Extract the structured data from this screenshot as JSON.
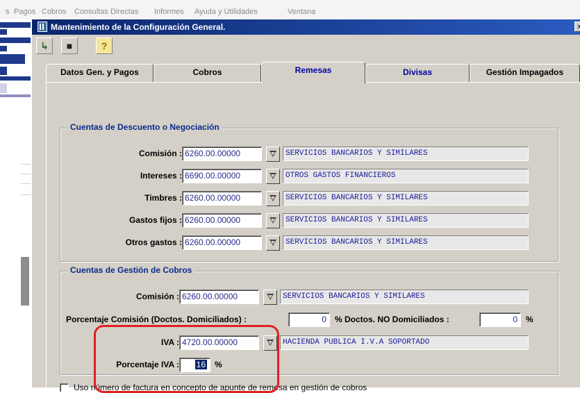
{
  "menubar": {
    "items": [
      "s",
      "Pagos",
      "Cobros",
      "Consultas Directas",
      "Informes",
      "Ayuda y Utilidades",
      "Ventana"
    ]
  },
  "window": {
    "title": "Mantenimiento de la Configuración General.",
    "close_glyph": "x"
  },
  "toolbar": {
    "exit_glyph": "↳",
    "save_glyph": "■",
    "help_glyph": "?"
  },
  "tabs": [
    {
      "label": "Datos Gen. y Pagos",
      "active": false
    },
    {
      "label": "Cobros",
      "active": false
    },
    {
      "label": "Remesas",
      "active": true
    },
    {
      "label": "Divisas",
      "active": false
    },
    {
      "label": "Gestión Impagados",
      "active": false
    }
  ],
  "descuento": {
    "title": "Cuentas de Descuento o Negociación",
    "rows": [
      {
        "label": "Comisión :",
        "account": "6260.00.00000",
        "description": "SERVICIOS BANCARIOS Y SIMILARES"
      },
      {
        "label": "Intereses :",
        "account": "6690.00.00000",
        "description": "OTROS GASTOS FINANCIEROS"
      },
      {
        "label": "Timbres :",
        "account": "6260.00.00000",
        "description": "SERVICIOS BANCARIOS Y SIMILARES"
      },
      {
        "label": "Gastos fijos :",
        "account": "6260.00.00000",
        "description": "SERVICIOS BANCARIOS Y SIMILARES"
      },
      {
        "label": "Otros gastos :",
        "account": "6260.00.00000",
        "description": "SERVICIOS BANCARIOS Y SIMILARES"
      }
    ]
  },
  "gestion": {
    "title": "Cuentas de Gestión de Cobros",
    "comision_label": "Comisión :",
    "comision_account": "6260.00.00000",
    "comision_description": "SERVICIOS BANCARIOS Y SIMILARES",
    "pct_domiciliados_label": "Porcentaje Comisión (Doctos. Domiciliados) :",
    "pct_domiciliados_value": "0",
    "pct_no_domiciliados_label": "% Doctos. NO Domiciliados :",
    "pct_no_domiciliados_value": "0",
    "pct_symbol": "%",
    "iva_label": "IVA :",
    "iva_account": "4720.00.00000",
    "iva_description": "HACIENDA PUBLICA I.V.A SOPORTADO",
    "pct_iva_label": "Porcentaje IVA :",
    "pct_iva_value": "16"
  },
  "checkbox": {
    "label": "Uso número de factura en concepto de apunte de remesa en gestión de cobros",
    "checked": false
  },
  "colors": {
    "titlebar": "#0a246a",
    "highlight": "#e02020",
    "group_title": "#0a2a8a"
  }
}
